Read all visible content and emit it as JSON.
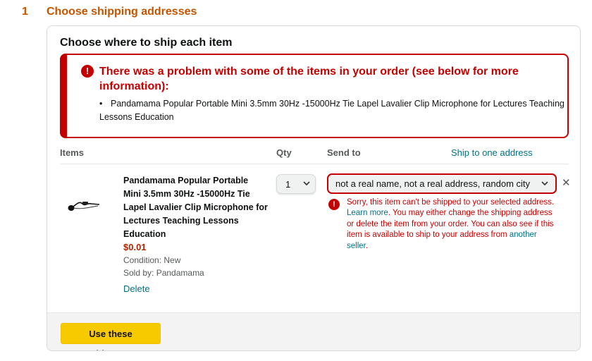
{
  "step": {
    "number": "1",
    "title": "Choose shipping addresses"
  },
  "card": {
    "title": "Choose where to ship each item"
  },
  "alert": {
    "heading": "There was a problem with some of the items in your order (see below for more information):",
    "items": [
      "Pandamama Popular Portable Mini 3.5mm 30Hz -15000Hz Tie Lapel Lavalier Clip Microphone for Lectures Teaching Lessons Education"
    ],
    "icon": "error-icon",
    "color": "#c40000"
  },
  "columns": {
    "items": "Items",
    "qty": "Qty",
    "send_to": "Send to",
    "ship_one_link": "Ship to one address"
  },
  "item": {
    "title": "Pandamama Popular Portable Mini 3.5mm 30Hz -15000Hz Tie Lapel Lavalier Clip Microphone for Lectures Teaching Lessons Education",
    "price": "$0.01",
    "condition": "Condition: New",
    "seller": "Sold by: Pandamama",
    "delete_label": "Delete",
    "qty": "1",
    "address": "not a real name, not a real address, random city",
    "remove_icon": "close-icon"
  },
  "error": {
    "text1": "Sorry, this item can't be shipped to your selected address. ",
    "learn_more": "Learn more",
    "text2": ". You may either change the shipping address or delete the item from your order. You can also see if this item is available to ship to your address from ",
    "another_seller": "another seller",
    "text3": "."
  },
  "footer": {
    "button_label": "Use these addresses"
  },
  "colors": {
    "accent": "#c45500",
    "error": "#c40000",
    "link": "#007185",
    "button": "#f7ca00",
    "price": "#b12704"
  }
}
